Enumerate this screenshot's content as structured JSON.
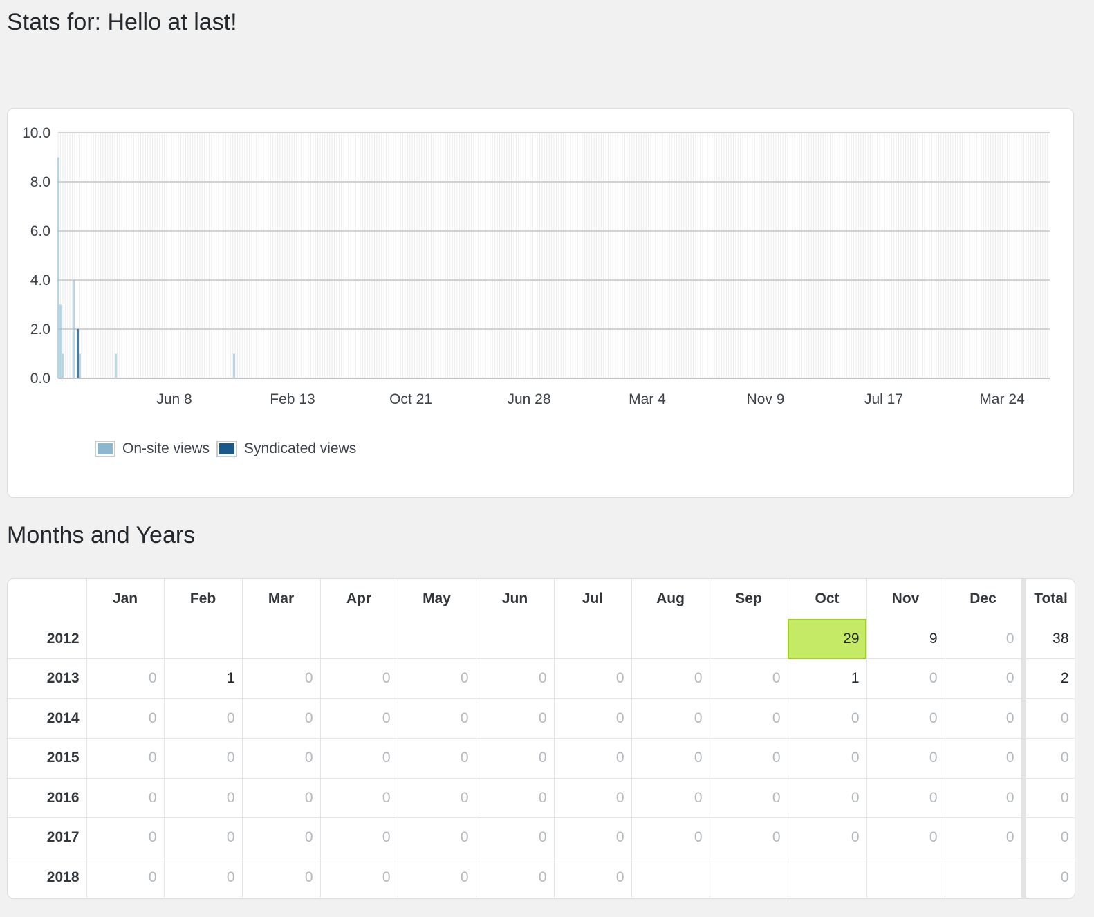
{
  "page": {
    "title": "Stats for: Hello at last!"
  },
  "chart_data": {
    "type": "bar",
    "ylim": [
      0,
      10
    ],
    "yticks": [
      "0.0",
      "2.0",
      "4.0",
      "6.0",
      "8.0",
      "10.0"
    ],
    "xtick_labels": [
      "Jun 8",
      "Feb 13",
      "Oct 21",
      "Jun 28",
      "Mar 4",
      "Nov 9",
      "Jul 17",
      "Mar 24"
    ],
    "grid": true,
    "legend_placement": "bottom-left",
    "series": [
      {
        "name": "On-site views",
        "color": "#8bb8cf"
      },
      {
        "name": "Syndicated views",
        "color": "#1a5a8a"
      }
    ],
    "notable_bars": [
      {
        "series": "On-site views",
        "value": 9
      },
      {
        "series": "On-site views",
        "value": 3
      },
      {
        "series": "On-site views",
        "value": 1
      },
      {
        "series": "On-site views",
        "value": 4
      },
      {
        "series": "Syndicated views",
        "value": 2
      },
      {
        "series": "On-site views",
        "value": 1
      },
      {
        "series": "On-site views",
        "value": 1
      },
      {
        "series": "On-site views",
        "value": 1
      }
    ]
  },
  "legend": {
    "onsite_label": "On-site views",
    "syndicated_label": "Syndicated views"
  },
  "months_section": {
    "title": "Months and Years",
    "headers": [
      "",
      "Jan",
      "Feb",
      "Mar",
      "Apr",
      "May",
      "Jun",
      "Jul",
      "Aug",
      "Sep",
      "Oct",
      "Nov",
      "Dec",
      "Total"
    ],
    "rows": [
      {
        "year": "2012",
        "cells": [
          "",
          "",
          "",
          "",
          "",
          "",
          "",
          "",
          "",
          "29",
          "9",
          "0"
        ],
        "total": "38"
      },
      {
        "year": "2013",
        "cells": [
          "0",
          "1",
          "0",
          "0",
          "0",
          "0",
          "0",
          "0",
          "0",
          "1",
          "0",
          "0"
        ],
        "total": "2"
      },
      {
        "year": "2014",
        "cells": [
          "0",
          "0",
          "0",
          "0",
          "0",
          "0",
          "0",
          "0",
          "0",
          "0",
          "0",
          "0"
        ],
        "total": "0"
      },
      {
        "year": "2015",
        "cells": [
          "0",
          "0",
          "0",
          "0",
          "0",
          "0",
          "0",
          "0",
          "0",
          "0",
          "0",
          "0"
        ],
        "total": "0"
      },
      {
        "year": "2016",
        "cells": [
          "0",
          "0",
          "0",
          "0",
          "0",
          "0",
          "0",
          "0",
          "0",
          "0",
          "0",
          "0"
        ],
        "total": "0"
      },
      {
        "year": "2017",
        "cells": [
          "0",
          "0",
          "0",
          "0",
          "0",
          "0",
          "0",
          "0",
          "0",
          "0",
          "0",
          "0"
        ],
        "total": "0"
      },
      {
        "year": "2018",
        "cells": [
          "0",
          "0",
          "0",
          "0",
          "0",
          "0",
          "0",
          "",
          "",
          "",
          "",
          ""
        ],
        "total": "0"
      }
    ],
    "highlight_color": "#c5ea66"
  }
}
